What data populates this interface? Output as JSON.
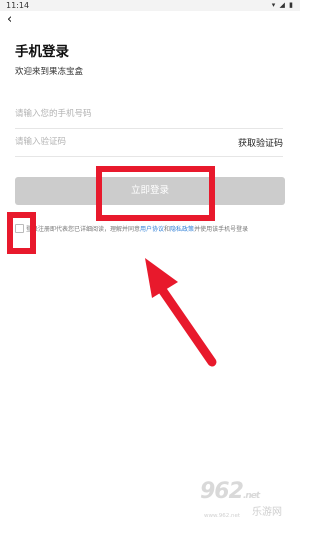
{
  "status_bar": {
    "time": "11:14",
    "icons": [
      "wifi-icon",
      "signal-icon",
      "battery-icon"
    ]
  },
  "header": {
    "back_icon": "chevron-left-icon"
  },
  "page": {
    "title": "手机登录",
    "subtitle": "欢迎来到果冻宝盒"
  },
  "form": {
    "phone_placeholder": "请输入您的手机号码",
    "code_placeholder": "请输入验证码",
    "get_code_label": "获取验证码",
    "login_label": "立即登录"
  },
  "agreement": {
    "prefix": "登录注册即代表您已详细阅读，理解并同意",
    "user_agreement": "用户协议",
    "and": "和",
    "privacy_policy": "隐私政策",
    "suffix": "并使用该手机号登录"
  },
  "watermark": {
    "logo": "962",
    "net": ".net",
    "name": "乐游网",
    "url": "www.962.net"
  },
  "colors": {
    "accent": "#e8192c",
    "link": "#2f7fd6",
    "button_disabled": "#cccccc"
  }
}
